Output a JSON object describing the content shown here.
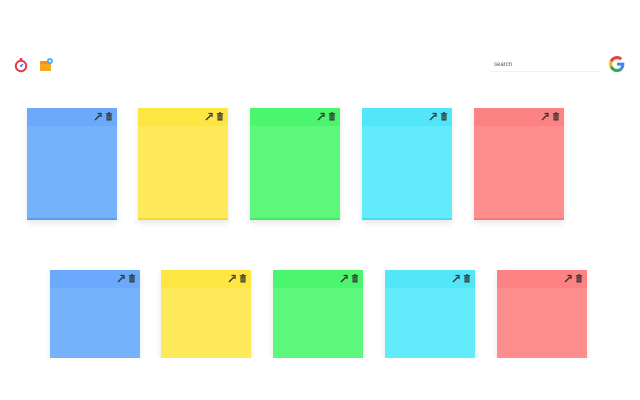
{
  "header": {
    "icons": [
      "stopwatch-icon",
      "sticky-notes-icon",
      "google-logo-icon"
    ]
  },
  "search": {
    "placeholder": "search",
    "value": ""
  },
  "colors": {
    "blue": {
      "head": "#6aa9fb",
      "body": "#74b2fc",
      "edge": "#5c9cf3"
    },
    "yellow": {
      "head": "#fde642",
      "body": "#fee95a",
      "edge": "#f2d83a"
    },
    "green": {
      "head": "#4cf56e",
      "body": "#5cf87c",
      "edge": "#45e864"
    },
    "cyan": {
      "head": "#53e6f8",
      "body": "#62ecfb",
      "edge": "#49dbef"
    },
    "red": {
      "head": "#fd8283",
      "body": "#fe8d8d",
      "edge": "#f37a7b"
    }
  },
  "notes": [
    {
      "row": 1,
      "color": "blue",
      "text": ""
    },
    {
      "row": 1,
      "color": "yellow",
      "text": ""
    },
    {
      "row": 1,
      "color": "green",
      "text": ""
    },
    {
      "row": 1,
      "color": "cyan",
      "text": ""
    },
    {
      "row": 1,
      "color": "red",
      "text": ""
    },
    {
      "row": 2,
      "color": "blue",
      "text": ""
    },
    {
      "row": 2,
      "color": "yellow",
      "text": ""
    },
    {
      "row": 2,
      "color": "green",
      "text": ""
    },
    {
      "row": 2,
      "color": "cyan",
      "text": ""
    },
    {
      "row": 2,
      "color": "red",
      "text": ""
    }
  ],
  "note_tools": [
    "expand-icon",
    "trash-icon"
  ]
}
